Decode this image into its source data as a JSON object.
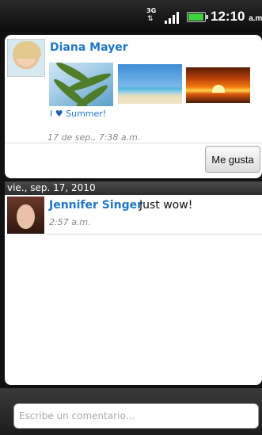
{
  "status_bar": {
    "network": "3G",
    "time": "12:10",
    "ampm": "a.m.",
    "battery_color": "#3fd23f"
  },
  "post": {
    "author": "Diana Mayer",
    "photos": [
      "palm-photo",
      "beach-photo",
      "sunset-photo"
    ],
    "caption_prefix": "I",
    "caption_suffix": "Summer!",
    "timestamp": "17 de sep., 7:38 a.m.",
    "like_label": "Me gusta"
  },
  "date_header": "vie., sep. 17, 2010",
  "comment": {
    "author": "Jennifer Singer",
    "text": "Just wow!",
    "timestamp": "2:57 a.m."
  },
  "comment_input": {
    "placeholder": "Escribe un comentario..."
  },
  "colors": {
    "link_blue": "#1f77c9",
    "background": "#111111"
  }
}
